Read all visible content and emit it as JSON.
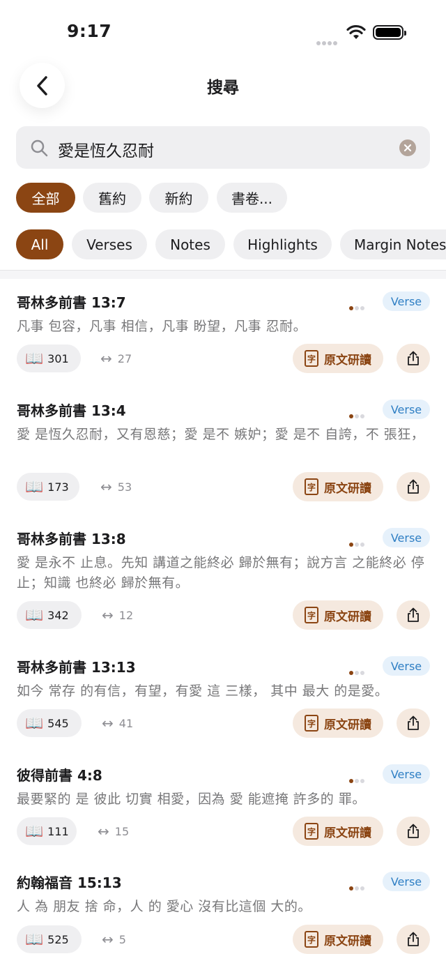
{
  "status_bar": {
    "time": "9:17"
  },
  "header": {
    "title": "搜尋"
  },
  "search": {
    "value": "愛是恆久忍耐"
  },
  "scope_filters": [
    {
      "label": "全部",
      "active": true
    },
    {
      "label": "舊約",
      "active": false
    },
    {
      "label": "新約",
      "active": false
    },
    {
      "label": "書卷...",
      "active": false
    }
  ],
  "type_filters": [
    {
      "label": "All",
      "active": true
    },
    {
      "label": "Verses",
      "active": false
    },
    {
      "label": "Notes",
      "active": false
    },
    {
      "label": "Highlights",
      "active": false
    },
    {
      "label": "Margin Notes",
      "active": false
    }
  ],
  "colors": {
    "accent": "#8b4513",
    "badge_bg": "#e6f1fb",
    "badge_text": "#2f7fc4"
  },
  "labels": {
    "study": "原文研讀",
    "study_glyph": "字",
    "badge": "Verse",
    "book_glyph": "📖",
    "xref_glyph": "↔"
  },
  "results": [
    {
      "reference": "哥林多前書 13:7",
      "text": "凡事 包容，凡事 相信，凡事 盼望，凡事 忍耐。",
      "count": "301",
      "xrefs": "27"
    },
    {
      "reference": "哥林多前書 13:4",
      "text": "愛 是恆久忍耐，又有恩慈；愛 是不 嫉妒；愛 是不 自誇，不 張狂，",
      "count": "173",
      "xrefs": "53"
    },
    {
      "reference": "哥林多前書 13:8",
      "text": "愛 是永不 止息。先知 講道之能終必 歸於無有；說方言 之能終必 停止；知識 也終必 歸於無有。",
      "count": "342",
      "xrefs": "12"
    },
    {
      "reference": "哥林多前書 13:13",
      "text": "如今 常存 的有信，有望，有愛 這 三樣， 其中 最大 的是愛。",
      "count": "545",
      "xrefs": "41"
    },
    {
      "reference": "彼得前書 4:8",
      "text": "最要緊的 是 彼此 切實 相愛，因為 愛 能遮掩 許多的 罪。",
      "count": "111",
      "xrefs": "15"
    },
    {
      "reference": "約翰福音 15:13",
      "text": "人 為 朋友 捨 命，人 的 愛心 沒有比這個 大的。",
      "count": "525",
      "xrefs": "5"
    }
  ]
}
